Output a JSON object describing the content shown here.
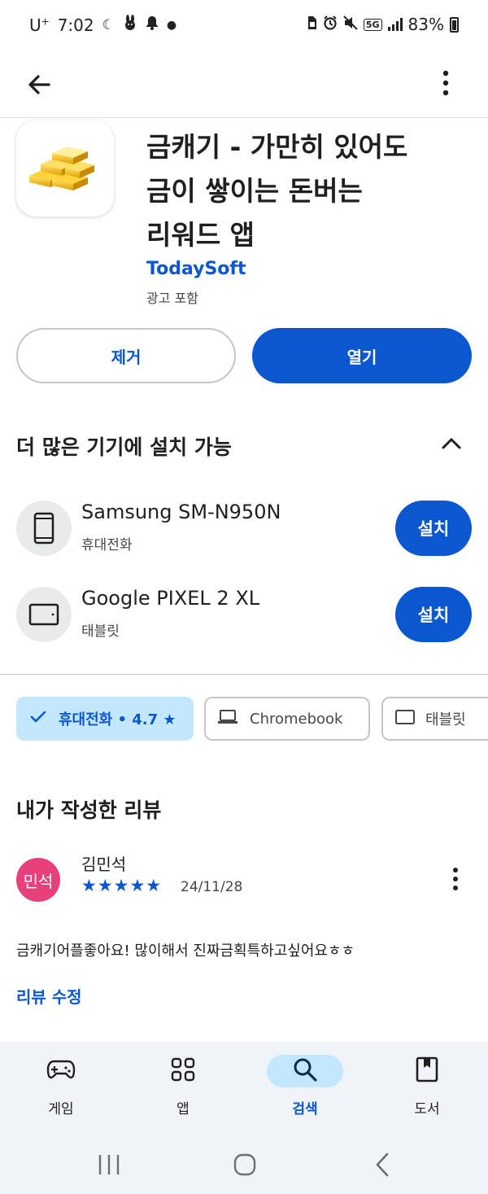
{
  "status_bar": {
    "carrier": "U",
    "carrier_sup": "+",
    "time": "7:02",
    "network": "5G",
    "battery": "83%"
  },
  "app": {
    "title_lines": [
      "금캐기 - 가만히 있어도",
      "금이 쌓이는 돈버는",
      "리워드 앱"
    ],
    "developer": "TodaySoft",
    "ads_notice": "광고 포함",
    "icon": "gold-bars-icon"
  },
  "actions": {
    "remove_label": "제거",
    "open_label": "열기"
  },
  "more_devices": {
    "title": "더 많은 기기에 설치 가능",
    "devices": [
      {
        "name": "Samsung SM-N950N",
        "type": "휴대전화",
        "install_label": "설치",
        "icon": "phone-icon"
      },
      {
        "name": "Google PIXEL 2 XL",
        "type": "태블릿",
        "install_label": "설치",
        "icon": "tablet-icon"
      }
    ]
  },
  "chips": {
    "phone": {
      "label": "휴대전화 • 4.7 ★",
      "selected": true
    },
    "chromebook": {
      "label": "Chromebook"
    },
    "tablet": {
      "label": "태블릿"
    }
  },
  "my_review": {
    "title": "내가 작성한 리뷰",
    "avatar_text": "민석",
    "avatar_color": "#e8407a",
    "reviewer": "김민석",
    "stars": "★★★★★",
    "rating": 5,
    "date": "24/11/28",
    "text": "금캐기어플좋아요! 많이해서 진짜금획특하고싶어요ㅎㅎ",
    "edit_label": "리뷰 수정"
  },
  "bottom_nav": {
    "items": [
      {
        "label": "게임",
        "icon": "gamepad-icon",
        "active": false
      },
      {
        "label": "앱",
        "icon": "apps-grid-icon",
        "active": false
      },
      {
        "label": "검색",
        "icon": "search-icon",
        "active": true
      },
      {
        "label": "도서",
        "icon": "book-icon",
        "active": false
      }
    ]
  },
  "colors": {
    "accent": "#0b57d0",
    "chip_selected_bg": "#c2e7ff",
    "nav_bg": "#f0f4f9"
  }
}
